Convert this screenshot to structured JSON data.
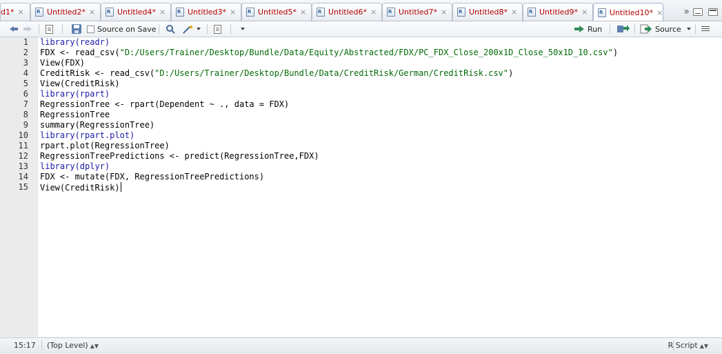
{
  "tabs": [
    {
      "label": "d1*"
    },
    {
      "label": "Untitled2*"
    },
    {
      "label": "Untitled4*"
    },
    {
      "label": "Untitled3*"
    },
    {
      "label": "Untitled5*"
    },
    {
      "label": "Untitled6*"
    },
    {
      "label": "Untitled7*"
    },
    {
      "label": "Untitled8*"
    },
    {
      "label": "Untitled9*"
    },
    {
      "label": "Untitled10*"
    }
  ],
  "tab_close_glyph": "×",
  "file_icon_letter": "R",
  "overflow_glyph": "»",
  "toolbar": {
    "source_on_save_label": "Source on Save",
    "run_label": "Run",
    "source_label": "Source"
  },
  "editor": {
    "lines": [
      {
        "n": "1"
      },
      {
        "n": "2"
      },
      {
        "n": "3"
      },
      {
        "n": "4"
      },
      {
        "n": "5"
      },
      {
        "n": "6"
      },
      {
        "n": "7"
      },
      {
        "n": "8"
      },
      {
        "n": "9"
      },
      {
        "n": "10"
      },
      {
        "n": "11"
      },
      {
        "n": "12"
      },
      {
        "n": "13"
      },
      {
        "n": "14"
      },
      {
        "n": "15"
      }
    ],
    "code": [
      [
        {
          "t": "library(readr)",
          "c": "kw"
        }
      ],
      [
        {
          "t": "FDX <- read_csv(",
          "c": ""
        },
        {
          "t": "\"D:/Users/Trainer/Desktop/Bundle/Data/Equity/Abstracted/FDX/PC_FDX_Close_200x1D_Close_50x1D_10.csv\"",
          "c": "str"
        },
        {
          "t": ")",
          "c": ""
        }
      ],
      [
        {
          "t": "View(FDX)",
          "c": ""
        }
      ],
      [
        {
          "t": "CreditRisk <- read_csv(",
          "c": ""
        },
        {
          "t": "\"D:/Users/Trainer/Desktop/Bundle/Data/CreditRisk/German/CreditRisk.csv\"",
          "c": "str"
        },
        {
          "t": ")",
          "c": ""
        }
      ],
      [
        {
          "t": "View(CreditRisk)",
          "c": ""
        }
      ],
      [
        {
          "t": "library(rpart)",
          "c": "kw"
        }
      ],
      [
        {
          "t": "RegressionTree <- rpart(Dependent ~ ., data = FDX)",
          "c": ""
        }
      ],
      [
        {
          "t": "RegressionTree",
          "c": ""
        }
      ],
      [
        {
          "t": "summary(RegressionTree)",
          "c": ""
        }
      ],
      [
        {
          "t": "library(rpart.plot)",
          "c": "kw"
        }
      ],
      [
        {
          "t": "rpart.plot(RegressionTree)",
          "c": ""
        }
      ],
      [
        {
          "t": "RegressionTreePredictions <- predict(RegressionTree,FDX)",
          "c": ""
        }
      ],
      [
        {
          "t": "library(dplyr)",
          "c": "kw"
        }
      ],
      [
        {
          "t": "FDX <- mutate(FDX, RegressionTreePredictions)",
          "c": ""
        }
      ],
      [
        {
          "t": "View(CreditRisk)",
          "c": ""
        }
      ]
    ]
  },
  "status": {
    "position": "15:17",
    "scope": "(Top Level)",
    "file_type": "R Script"
  },
  "colors": {
    "keyword": "#1a1aa6",
    "string": "#036a07",
    "tab_modified_text": "#b30000"
  }
}
